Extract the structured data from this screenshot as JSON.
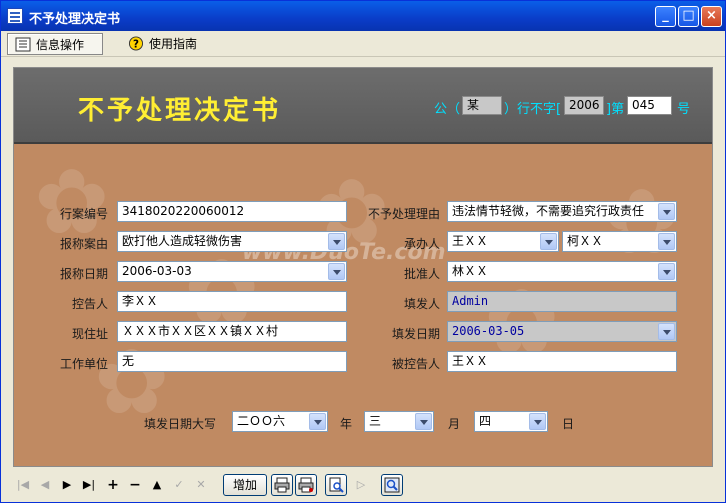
{
  "window": {
    "title": "不予处理决定书"
  },
  "toolbar": {
    "tab1": "信息操作",
    "tab2": "使用指南"
  },
  "doc": {
    "title": "不予处理决定书",
    "prefix": "公（",
    "agency": "某",
    "mid": "）行不字[",
    "year": "2006",
    "mid2": "]第",
    "number": "045",
    "suffix": "号"
  },
  "form": {
    "case_no_label": "行案编号",
    "case_no": "3418020220060012",
    "reason_label": "不予处理理由",
    "reason": "违法情节轻微，不需要追究行政责任",
    "case_cause_label": "报称案由",
    "case_cause": "欧打他人造成轻微伤害",
    "handler_label": "承办人",
    "handler1": "王ＸＸ",
    "handler2": "柯ＸＸ",
    "report_date_label": "报称日期",
    "report_date": "2006-03-03",
    "approver_label": "批准人",
    "approver": "林ＸＸ",
    "accuser_label": "控告人",
    "accuser": "李ＸＸ",
    "issuer_label": "填发人",
    "issuer": "Admin",
    "address_label": "现住址",
    "address": "ＸＸＸ市ＸＸ区ＸＸ镇ＸＸ村",
    "issue_date_label": "填发日期",
    "issue_date": "2006-03-05",
    "workplace_label": "工作单位",
    "workplace": "无",
    "accused_label": "被控告人",
    "accused": "王ＸＸ",
    "date_upper_label": "填发日期大写",
    "year_upper": "二ＯＯ六",
    "year_unit": "年",
    "month_upper": "三",
    "month_unit": "月",
    "day_upper": "四",
    "day_unit": "日"
  },
  "nav": {
    "add_label": "增加"
  },
  "watermark": {
    "text": "www.DuoTe.com"
  }
}
